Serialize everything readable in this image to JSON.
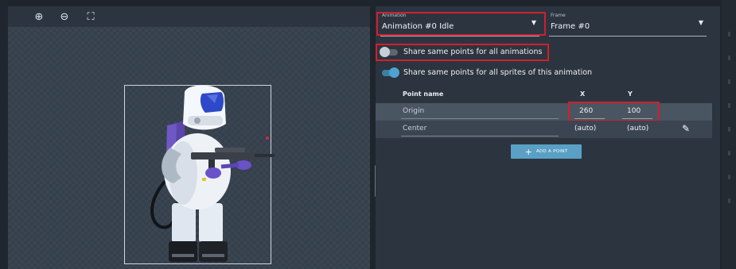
{
  "canvas": {
    "toolbar": [
      {
        "name": "zoom-in-icon",
        "glyph": "⊕"
      },
      {
        "name": "zoom-out-icon",
        "glyph": "⊖"
      },
      {
        "name": "fit-screen-icon",
        "glyph": "⛶"
      }
    ]
  },
  "panel": {
    "animation_field": {
      "label": "Animation",
      "value": "Animation #0 Idle"
    },
    "frame_field": {
      "label": "Frame",
      "value": "Frame #0"
    },
    "toggles": [
      {
        "label": "Share same points for all animations",
        "checked": false
      },
      {
        "label": "Share same points for all sprites of this animation",
        "checked": true
      }
    ],
    "table": {
      "headers": {
        "name": "Point name",
        "x": "X",
        "y": "Y"
      },
      "rows": [
        {
          "name": "Origin",
          "x": "260",
          "y": "100"
        },
        {
          "name": "Center",
          "x": "(auto)",
          "y": "(auto)"
        }
      ]
    },
    "add_point_label": "ADD A POINT"
  },
  "colors": {
    "accent": "#5aa0c4",
    "highlight": "#d0202c",
    "toggle_on": "#4fa3d1"
  }
}
